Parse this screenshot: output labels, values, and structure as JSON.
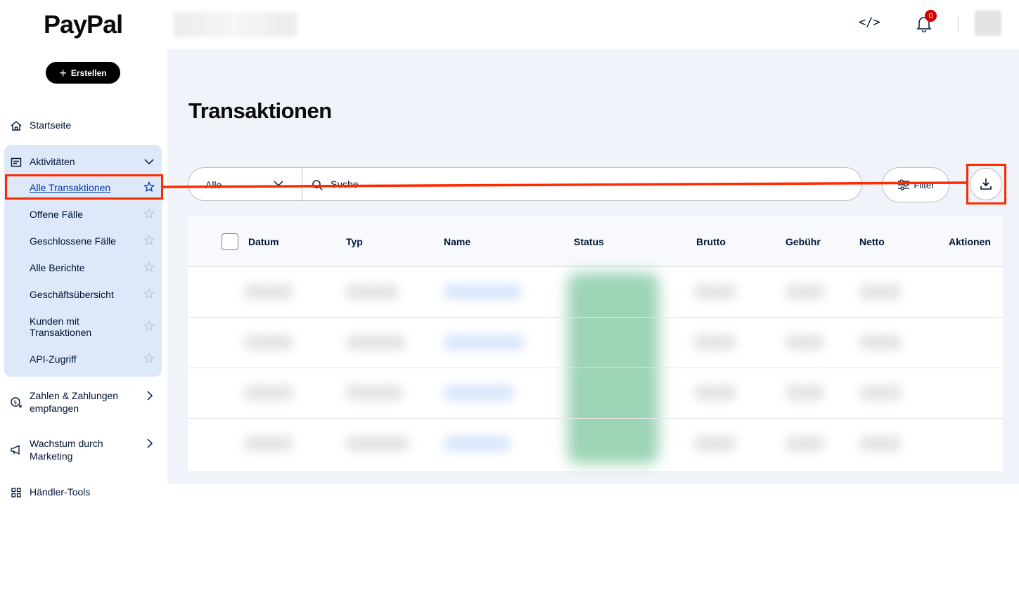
{
  "brand": {
    "logo_text": "PayPal"
  },
  "sidebar": {
    "create_label": "Erstellen",
    "items": [
      {
        "label": "Startseite",
        "icon": "home-icon"
      },
      {
        "label": "Aktivitäten",
        "icon": "activity-list-icon"
      },
      {
        "label": "Zahlen & Zahlungen empfangen",
        "line1": "Zahlen & Zahlungen",
        "line2": "empfangen",
        "icon": "money-send-icon"
      },
      {
        "label": "Wachstum durch Marketing",
        "line1": "Wachstum durch",
        "line2": "Marketing",
        "icon": "megaphone-icon"
      },
      {
        "label": "Händler-Tools",
        "icon": "grid-icon"
      }
    ],
    "sub_items": [
      {
        "label": "Alle Transaktionen",
        "active": true
      },
      {
        "label": "Offene Fälle"
      },
      {
        "label": "Geschlossene Fälle"
      },
      {
        "label": "Alle Berichte"
      },
      {
        "label": "Geschäftsübersicht"
      },
      {
        "label": "Kunden mit Transaktionen",
        "line1": "Kunden mit",
        "line2": "Transaktionen"
      },
      {
        "label": "API-Zugriff"
      }
    ]
  },
  "header": {
    "notifications_count": "0",
    "code_icon_glyph": "</>"
  },
  "main": {
    "title": "Transaktionen",
    "filter_select_value": "Alle",
    "search_placeholder": "Suche",
    "filter_label": "Filter"
  },
  "table": {
    "columns": [
      "Datum",
      "Typ",
      "Name",
      "Status",
      "Brutto",
      "Gebühr",
      "Netto",
      "Aktionen"
    ]
  },
  "colors": {
    "accent": "#ff2a00",
    "active_bg": "#dde8f8",
    "main_bg": "#f1f3fa",
    "badge": "#d20000"
  }
}
